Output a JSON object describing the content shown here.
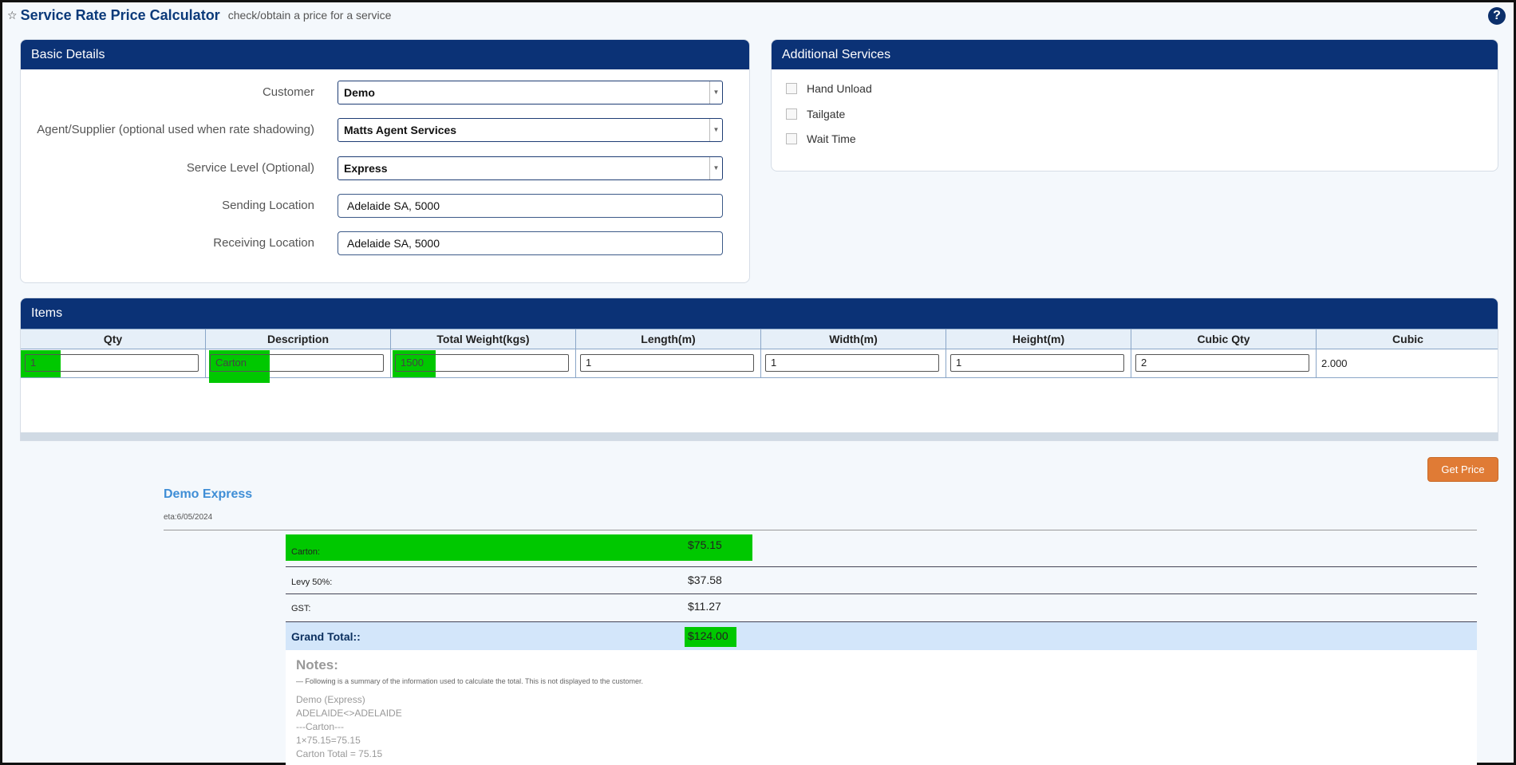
{
  "header": {
    "title": "Service Rate Price Calculator",
    "subtitle": "check/obtain a price for a service",
    "help_label": "?"
  },
  "basic": {
    "title": "Basic Details",
    "customer_label": "Customer",
    "customer_value": "Demo",
    "agent_label": "Agent/Supplier (optional used when rate shadowing)",
    "agent_value": "Matts Agent Services",
    "service_label": "Service Level (Optional)",
    "service_value": "Express",
    "sending_label": "Sending Location",
    "sending_value": "Adelaide SA, 5000",
    "receiving_label": "Receiving Location",
    "receiving_value": "Adelaide SA, 5000"
  },
  "additional": {
    "title": "Additional Services",
    "options": [
      "Hand Unload",
      "Tailgate",
      "Wait Time"
    ]
  },
  "items": {
    "title": "Items",
    "columns": [
      "Qty",
      "Description",
      "Total Weight(kgs)",
      "Length(m)",
      "Width(m)",
      "Height(m)",
      "Cubic Qty",
      "Cubic"
    ],
    "row": {
      "qty": "1",
      "description": "Carton",
      "weight": "1500",
      "length": "1",
      "width": "1",
      "height": "1",
      "cubic_qty": "2",
      "cubic": "2.000"
    }
  },
  "actions": {
    "get_price": "Get Price"
  },
  "result": {
    "title": "Demo Express",
    "eta": "eta:6/05/2024",
    "lines": [
      {
        "label": "Carton:",
        "value": "$75.15"
      },
      {
        "label": "Levy 50%:",
        "value": "$37.58"
      },
      {
        "label": "GST:",
        "value": "$11.27"
      }
    ],
    "grand_label": "Grand Total::",
    "grand_value": "$124.00"
  },
  "notes": {
    "title": "Notes:",
    "subtitle": "— Following is a summary of the information used to calculate the total. This is not displayed to the customer.",
    "lines": [
      "Demo (Express)",
      "ADELAIDE<>ADELAIDE",
      "---Carton---",
      "1×75.15=75.15",
      "Carton Total = 75.15"
    ]
  },
  "colors": {
    "header_blue": "#0b3276",
    "highlight_green": "#00c800",
    "button_orange": "#e07b35"
  }
}
